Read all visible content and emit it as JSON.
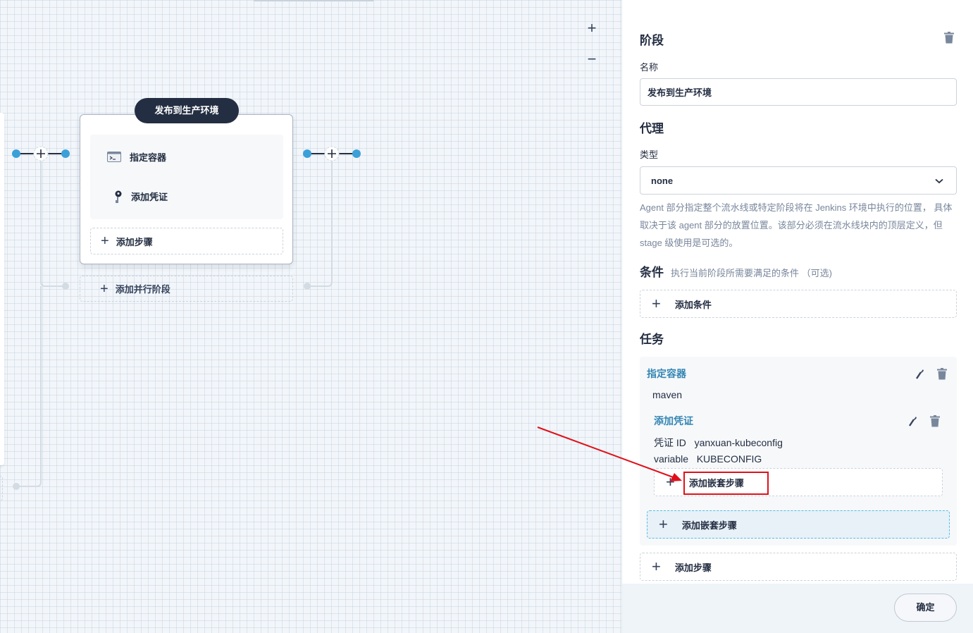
{
  "canvas": {
    "zoom_in": "+",
    "zoom_out": "−",
    "stage": {
      "title": "发布到生产环境",
      "steps": [
        {
          "label": "指定容器",
          "icon": "terminal-icon"
        },
        {
          "label": "添加凭证",
          "icon": "key-icon"
        }
      ],
      "add_step_label": "添加步骤",
      "add_parallel_label": "添加并行阶段"
    }
  },
  "panel": {
    "stage_heading": "阶段",
    "name_label": "名称",
    "name_value": "发布到生产环境",
    "agent_heading": "代理",
    "type_label": "类型",
    "type_value": "none",
    "agent_desc": "Agent 部分指定整个流水线或特定阶段将在 Jenkins 环境中执行的位置， 具体取决于该 agent 部分的放置位置。该部分必须在流水线块内的顶层定义，但 stage 级使用是可选的。",
    "condition_heading": "条件",
    "condition_desc": "执行当前阶段所需要满足的条件 （可选)",
    "add_condition_label": "添加条件",
    "tasks_heading": "任务",
    "task": {
      "container_link": "指定容器",
      "container_value": "maven",
      "credential_link": "添加凭证",
      "credential_id_label": "凭证 ID",
      "credential_id_value": "yanxuan-kubeconfig",
      "variable_label": "variable",
      "variable_value": "KUBECONFIG",
      "add_nested_inner_label": "添加嵌套步骤",
      "add_nested_outer_label": "添加嵌套步骤"
    },
    "add_step_label": "添加步骤",
    "confirm_label": "确定"
  },
  "colors": {
    "accent_link": "#3385b3",
    "node_blue": "#3ca0d8",
    "highlight_red": "#e0101a",
    "dark": "#242e42"
  }
}
